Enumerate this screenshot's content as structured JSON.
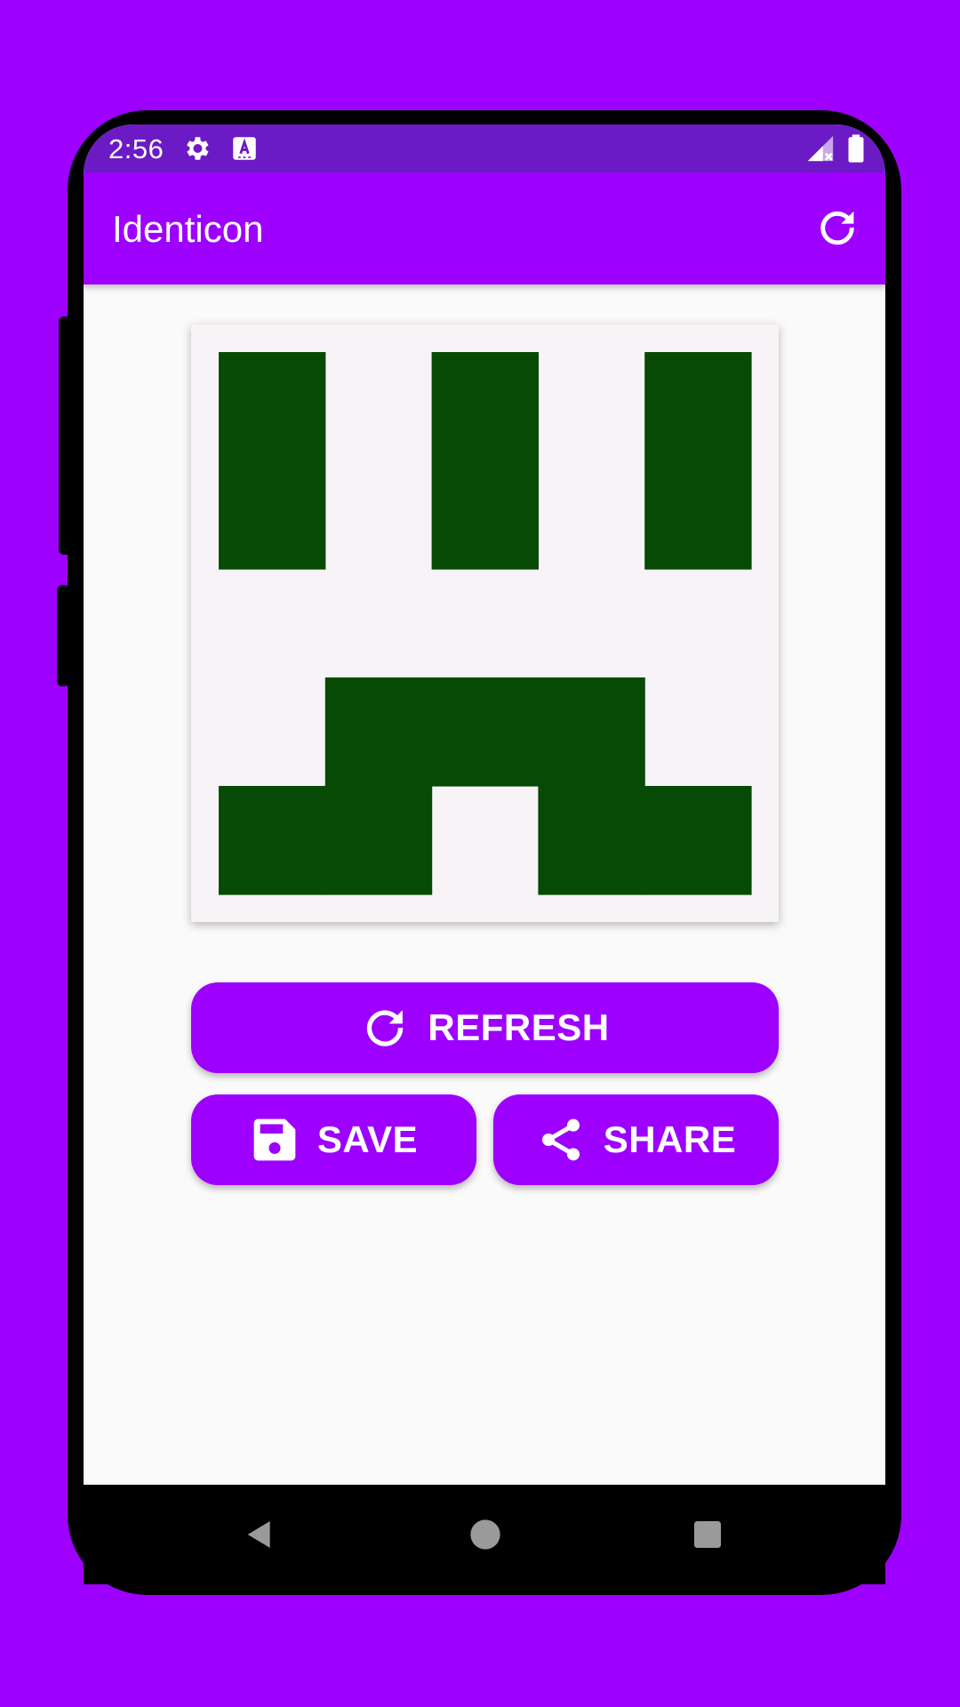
{
  "status_bar": {
    "time": "2:56",
    "icons": [
      "gear-icon",
      "text-a-icon",
      "signal-off-icon",
      "battery-icon"
    ]
  },
  "app_bar": {
    "title": "Identicon",
    "action_icon": "refresh-icon"
  },
  "identicon": {
    "foreground_color": "#074a06",
    "background_color": "#f7f3f7",
    "grid": [
      [
        1,
        0,
        1,
        0,
        1
      ],
      [
        1,
        0,
        1,
        0,
        1
      ],
      [
        0,
        0,
        0,
        0,
        0
      ],
      [
        0,
        1,
        1,
        1,
        0
      ],
      [
        1,
        1,
        0,
        1,
        1
      ]
    ]
  },
  "buttons": {
    "refresh": {
      "label": "REFRESH",
      "icon": "refresh-icon"
    },
    "save": {
      "label": "SAVE",
      "icon": "floppy-disk-icon"
    },
    "share": {
      "label": "SHARE",
      "icon": "share-icon"
    }
  },
  "nav_bar": {
    "icons": [
      "back-icon",
      "home-icon",
      "recents-icon"
    ]
  },
  "colors": {
    "background": "#9e00ff",
    "status_bar": "#6b1ac5",
    "accent": "#9e00ff",
    "screen": "#fafafa"
  }
}
